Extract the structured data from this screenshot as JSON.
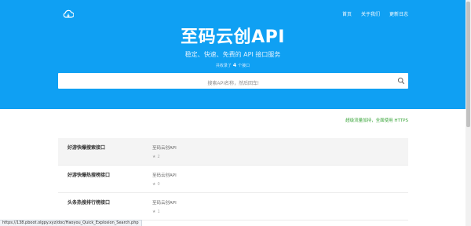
{
  "colors": {
    "hero_bg": "#0fa0f3",
    "accent_green": "#3aa53a",
    "row_active_bg": "#f4f4f4"
  },
  "header": {
    "logo_icon": "cloud-icon",
    "nav": [
      {
        "label": "首页"
      },
      {
        "label": "关于我们"
      },
      {
        "label": "更新日志"
      }
    ]
  },
  "hero": {
    "title": "至码云创API",
    "subtitle": "稳定、快速、免费的 API 接口服务",
    "count_prefix": "共收录了",
    "count_value": "4",
    "count_suffix": "个接口"
  },
  "search": {
    "placeholder": "搜索API名称，然后回车!",
    "icon": "search-icon"
  },
  "notice": "超级流量加持，全面使用 HTTPS",
  "apis": [
    {
      "name": "好游快爆搜索接口",
      "author": "至码云创API",
      "stars": "2"
    },
    {
      "name": "好游快爆热搜榜接口",
      "author": "至码云创API",
      "stars": "0"
    },
    {
      "name": "头条热搜排行榜接口",
      "author": "至码云创API",
      "stars": "1"
    }
  ],
  "status_url": "https://138.pboot.olgpy.xyz/doc/Haoyou_Quick_Explosion_Search.php"
}
